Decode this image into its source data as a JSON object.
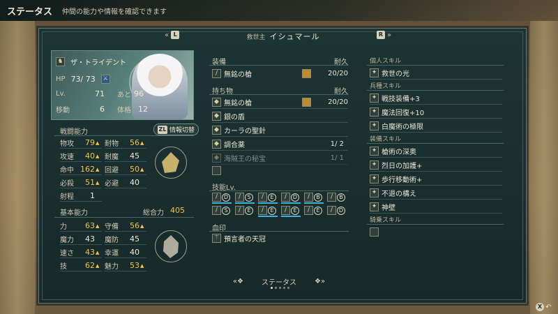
{
  "topbar": {
    "title": "ステータス",
    "subtitle": "仲間の能力や情報を確認できます"
  },
  "header": {
    "left_key": "L",
    "right_key": "R",
    "epithet": "救世主",
    "name": "イシュマール"
  },
  "unit": {
    "class": "ザ・トライデント",
    "hp_label": "HP",
    "hp": "73/ 73",
    "lv_label": "Lv.",
    "lv": "71",
    "exp_label": "あと",
    "exp": "96",
    "move_label": "移動",
    "move": "6",
    "build_label": "体格",
    "build": "12"
  },
  "combat": {
    "title": "戦闘能力",
    "toggle": "情報切替",
    "toggle_key": "ZL",
    "stats": [
      {
        "label": "物攻",
        "value": "79",
        "up": true
      },
      {
        "label": "耐物",
        "value": "56",
        "up": true
      },
      {
        "label": "攻速",
        "value": "40",
        "up": true
      },
      {
        "label": "耐魔",
        "value": "45",
        "up": false
      },
      {
        "label": "命中",
        "value": "162",
        "up": true
      },
      {
        "label": "回避",
        "value": "50",
        "up": true
      },
      {
        "label": "必殺",
        "value": "51",
        "up": true
      },
      {
        "label": "必避",
        "value": "40",
        "up": false
      },
      {
        "label": "射程",
        "value": "1",
        "up": false
      }
    ]
  },
  "basic": {
    "title": "基本能力",
    "total_label": "総合力",
    "total": "405",
    "stats": [
      {
        "label": "力",
        "value": "63",
        "up": true
      },
      {
        "label": "守備",
        "value": "56",
        "up": true
      },
      {
        "label": "魔力",
        "value": "43",
        "up": false
      },
      {
        "label": "魔防",
        "value": "45",
        "up": false
      },
      {
        "label": "速さ",
        "value": "43",
        "up": true
      },
      {
        "label": "幸運",
        "value": "40",
        "up": false
      },
      {
        "label": "技",
        "value": "62",
        "up": true
      },
      {
        "label": "魅力",
        "value": "53",
        "up": true
      }
    ]
  },
  "equip": {
    "title": "装備",
    "dur_label": "耐久",
    "weapon": "無銘の槍",
    "weapon_dur": "20/20"
  },
  "items": {
    "title": "持ち物",
    "dur_label": "耐久",
    "list": [
      {
        "name": "無銘の槍",
        "dur": "20/20"
      },
      {
        "name": "銀の盾",
        "dur": ""
      },
      {
        "name": "カーラの聖針",
        "dur": ""
      },
      {
        "name": "調合薬",
        "dur": "1/ 2"
      },
      {
        "name": "海賊王の秘宝",
        "dur": "1/ 1"
      }
    ]
  },
  "skills_lv": {
    "title": "技能Lv.",
    "ranks": [
      "D",
      "S",
      "E",
      "D",
      "B",
      "B",
      "S",
      "E",
      "E",
      "E",
      "E",
      "D"
    ]
  },
  "blood": {
    "title": "血印",
    "name": "預言者の天冠"
  },
  "personal": {
    "title": "個人スキル",
    "list": [
      "救世の光"
    ]
  },
  "class_skill": {
    "title": "兵種スキル",
    "list": [
      "戦技装備+3",
      "魔法回復+10",
      "白魔術の極限"
    ]
  },
  "equip_skill": {
    "title": "装備スキル",
    "list": [
      "槍術の深奥",
      "烈日の加護+",
      "歩行移動術+",
      "不退の構え",
      "神壁"
    ]
  },
  "mount_skill": {
    "title": "騎乗スキル"
  },
  "bottom": {
    "label": "ステータス",
    "key": "X"
  },
  "colors": {
    "panel": "#1d3434",
    "accent": "#f0c34a",
    "line": "#4a6660"
  }
}
